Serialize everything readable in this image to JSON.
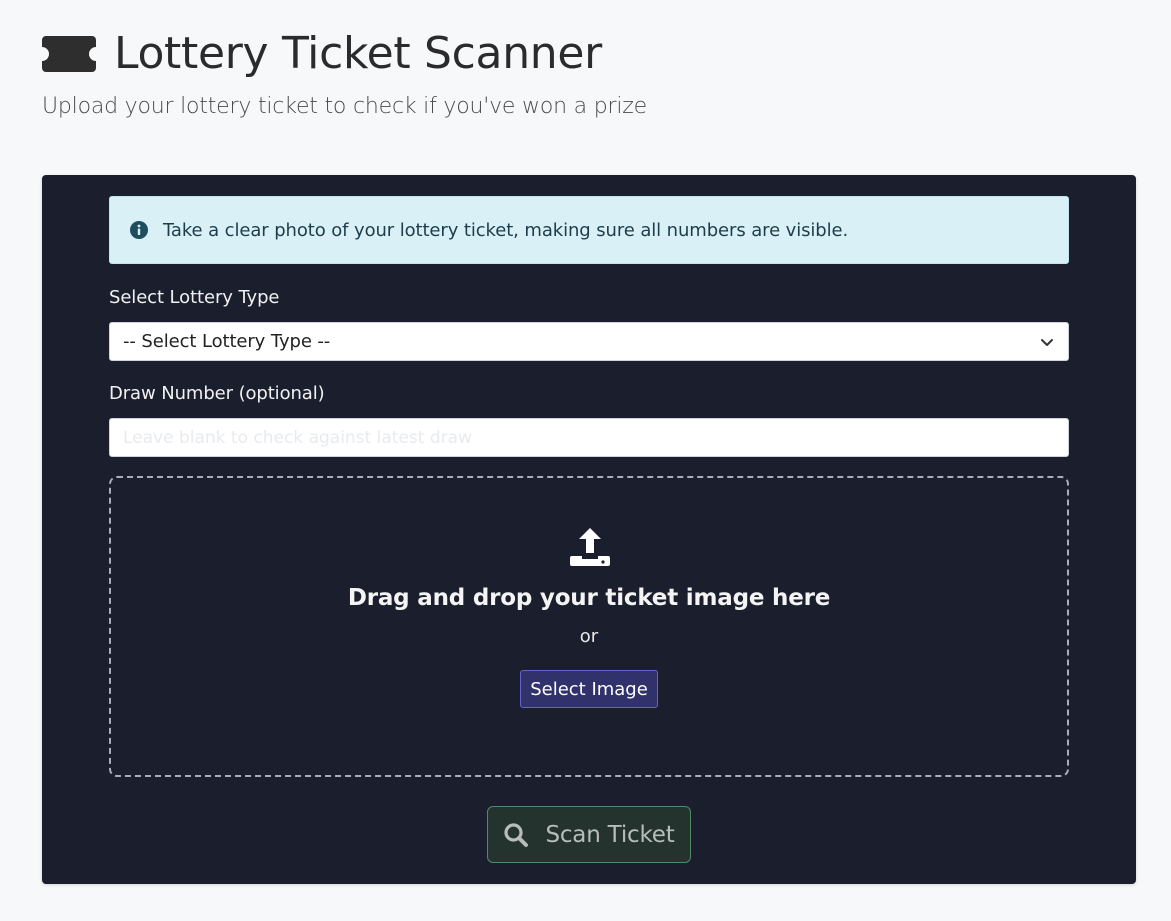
{
  "header": {
    "icon": "ticket-icon",
    "title": "Lottery Ticket Scanner",
    "subtitle": "Upload your lottery ticket to check if you've won a prize"
  },
  "alert": {
    "icon": "info-circle-icon",
    "text": "Take a clear photo of your lottery ticket, making sure all numbers are visible."
  },
  "form": {
    "lottery_type": {
      "label": "Select Lottery Type",
      "selected": "-- Select Lottery Type --"
    },
    "draw_number": {
      "label": "Draw Number (optional)",
      "value": "",
      "placeholder": "Leave blank to check against latest draw"
    }
  },
  "dropzone": {
    "icon": "upload-icon",
    "title": "Drag and drop your ticket image here",
    "or_text": "or",
    "button_label": "Select Image"
  },
  "scan_button": {
    "icon": "search-icon",
    "label": "Scan Ticket"
  },
  "colors": {
    "page_bg": "#f7f8fa",
    "card_bg": "#1b1f2d",
    "alert_bg": "#daf0f7",
    "select_image_btn": "#31316b",
    "scan_btn_border": "#4f8a64"
  }
}
